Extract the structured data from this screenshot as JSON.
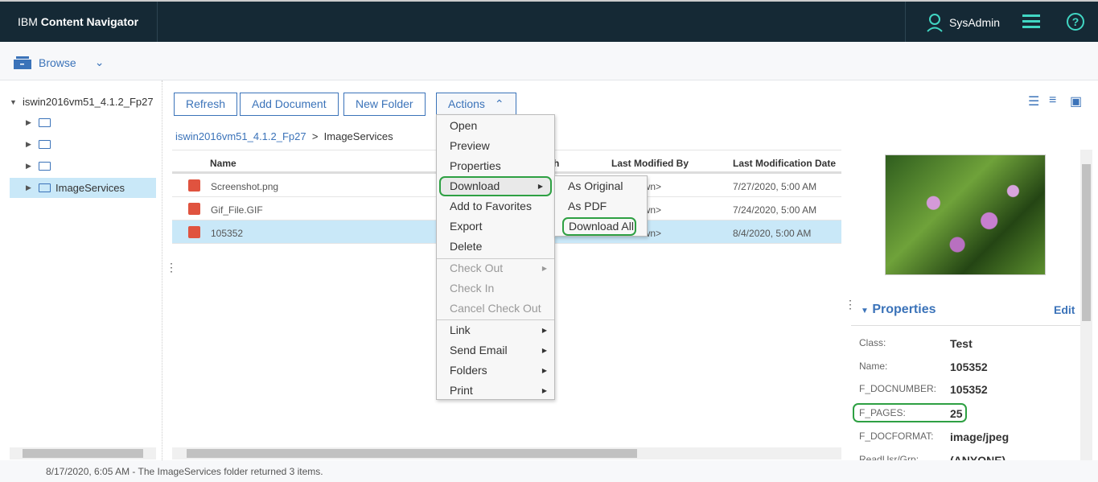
{
  "header": {
    "brand_prefix": "IBM",
    "brand_name": "Content Navigator",
    "user": "SysAdmin",
    "icons": [
      "user-icon",
      "hamburger-menu-icon",
      "help-icon"
    ]
  },
  "nav": {
    "feature": "Browse",
    "icon": "browse-icon"
  },
  "tree": {
    "root": "iswin2016vm51_4.1.2_Fp27",
    "selected": "ImageServices"
  },
  "toolbar": {
    "refresh": "Refresh",
    "add_document": "Add Document",
    "new_folder": "New Folder",
    "actions": "Actions"
  },
  "breadcrumb": {
    "root": "iswin2016vm51_4.1.2_Fp27",
    "current": "ImageServices"
  },
  "grid": {
    "columns": {
      "name": "Name",
      "partial": "th",
      "modified_by": "Last Modified By",
      "modified_date": "Last Modification Date"
    },
    "rows": [
      {
        "name": "Screenshot.png",
        "modified_by": "<unknown>",
        "date": "7/27/2020, 5:00 AM"
      },
      {
        "name": "Gif_File.GIF",
        "modified_by": "<unknown>",
        "date": "7/24/2020, 5:00 AM"
      },
      {
        "name": "105352",
        "modified_by": "<unknown>",
        "date": "8/4/2020, 5:00 AM",
        "selected": true
      }
    ]
  },
  "context_menu": {
    "items": [
      "Open",
      "Preview",
      "Properties",
      "Download",
      "Add to Favorites",
      "Export",
      "Delete",
      "Check Out",
      "Check In",
      "Cancel Check Out",
      "Link",
      "Send Email",
      "Folders",
      "Print"
    ]
  },
  "download_submenu": {
    "items": [
      "As Original",
      "As PDF",
      "Download All"
    ]
  },
  "properties": {
    "title": "Properties",
    "edit": "Edit",
    "rows": [
      {
        "label": "Class:",
        "value": "Test"
      },
      {
        "label": "Name:",
        "value": "105352"
      },
      {
        "label": "F_DOCNUMBER:",
        "value": "105352"
      },
      {
        "label": "F_PAGES:",
        "value": "25"
      },
      {
        "label": "F_DOCFORMAT:",
        "value": "image/jpeg"
      },
      {
        "label": "ReadUsr/Grp:",
        "value": "(ANYONE)"
      }
    ]
  },
  "status": "8/17/2020, 6:05 AM - The ImageServices folder returned 3 items.",
  "colors": {
    "header": "#152935",
    "accent": "#3b73b9",
    "selection": "#c9e8f8",
    "highlight": "#2ea043"
  }
}
